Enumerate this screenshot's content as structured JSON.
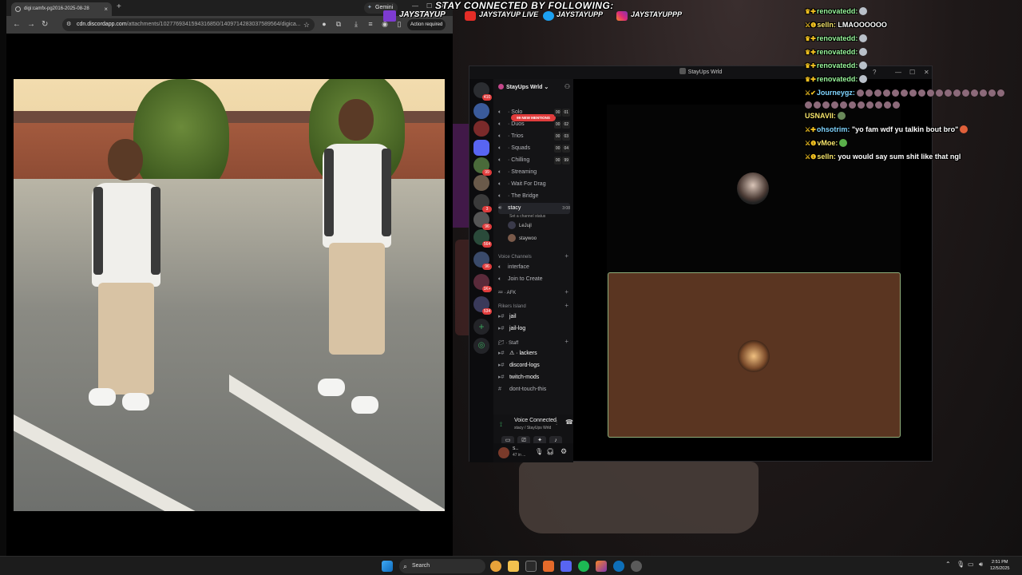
{
  "browser": {
    "tab_title": "digi:camfx-pg2016-2025-08-28",
    "tab_close": "×",
    "new_tab": "+",
    "gemini_label": "Gemini",
    "url_host": "cdn.discordapp.com",
    "url_path": "/attachments/1027769341594316850/1409714283037589564/digica...",
    "action_required": "Action required"
  },
  "overlay": {
    "headline": "STAY CONNECTED BY FOLLOWING:",
    "twitch_handle": "JAYSTAYUP",
    "youtube": "JAYSTAYUP LIVE",
    "twitter": "JAYSTAYUPP",
    "instagram": "JAYSTAYUPPP"
  },
  "discord": {
    "window_title": "StayUps Wrld",
    "server_name": "StayUps Wrld",
    "mentions_badge": "99 NEW MENTIONS",
    "guild_badges": [
      "410",
      "99",
      "3",
      "96",
      "564",
      "96",
      "1K+",
      "534"
    ],
    "channels": [
      {
        "name": "Solo",
        "count": [
          "00",
          "01"
        ]
      },
      {
        "name": "Duos",
        "count": [
          "00",
          "02"
        ]
      },
      {
        "name": "Trios",
        "count": [
          "00",
          "03"
        ]
      },
      {
        "name": "Squads",
        "count": [
          "00",
          "04"
        ]
      },
      {
        "name": "Chilling",
        "count": [
          "00",
          "99"
        ]
      },
      {
        "name": "Streaming"
      },
      {
        "name": "Wait For Drag"
      },
      {
        "name": "The Bridge"
      }
    ],
    "active_channel": {
      "name": "stacy",
      "time": "3:08",
      "status": "Set a channel status"
    },
    "voice_users": [
      "LeJujl",
      "staywoo"
    ],
    "voice_category": "Voice Channels",
    "voice_channels": [
      "interface",
      "Join to Create"
    ],
    "afk_category": "AFK",
    "rikers_category": "Rikers Island",
    "rikers_channels": [
      "jail",
      "jail-log"
    ],
    "staff_category": "Staff",
    "staff_channels": [
      "lackers",
      "discord-logs",
      "twitch-mods",
      "dont-touch-this"
    ],
    "voice_connected": "Voice Connected",
    "voice_location": "stacy / StayUps Wrld",
    "user_name": "S...",
    "user_status": "47 in ..."
  },
  "chat": [
    {
      "name": "renovatedd:",
      "text": ""
    },
    {
      "name": "selln:",
      "text": "LMAOOOOOO"
    },
    {
      "name": "renovatedd:",
      "text": ""
    },
    {
      "name": "renovatedd:",
      "text": ""
    },
    {
      "name": "renovatedd:",
      "text": ""
    },
    {
      "name": "renovatedd:",
      "text": ""
    },
    {
      "name": "Journeygz:",
      "text": ""
    },
    {
      "name": "USNAVII:",
      "text": ""
    },
    {
      "name": "ohsotrim:",
      "text": "\"yo fam wdf yu talkin bout bro\""
    },
    {
      "name": "vMoe:",
      "text": ""
    },
    {
      "name": "selln:",
      "text": "you would say sum shit like that ngl"
    }
  ],
  "taskbar": {
    "search_label": "Search",
    "time": "2:51 PM",
    "date": "12/5/2025"
  },
  "colors": {
    "discord_bg": "#0e0e10",
    "tile_bg": "#5a3521",
    "tile_border": "#8fae7b",
    "chat_name": "#98f59a",
    "mention_red": "#e03c3c"
  }
}
